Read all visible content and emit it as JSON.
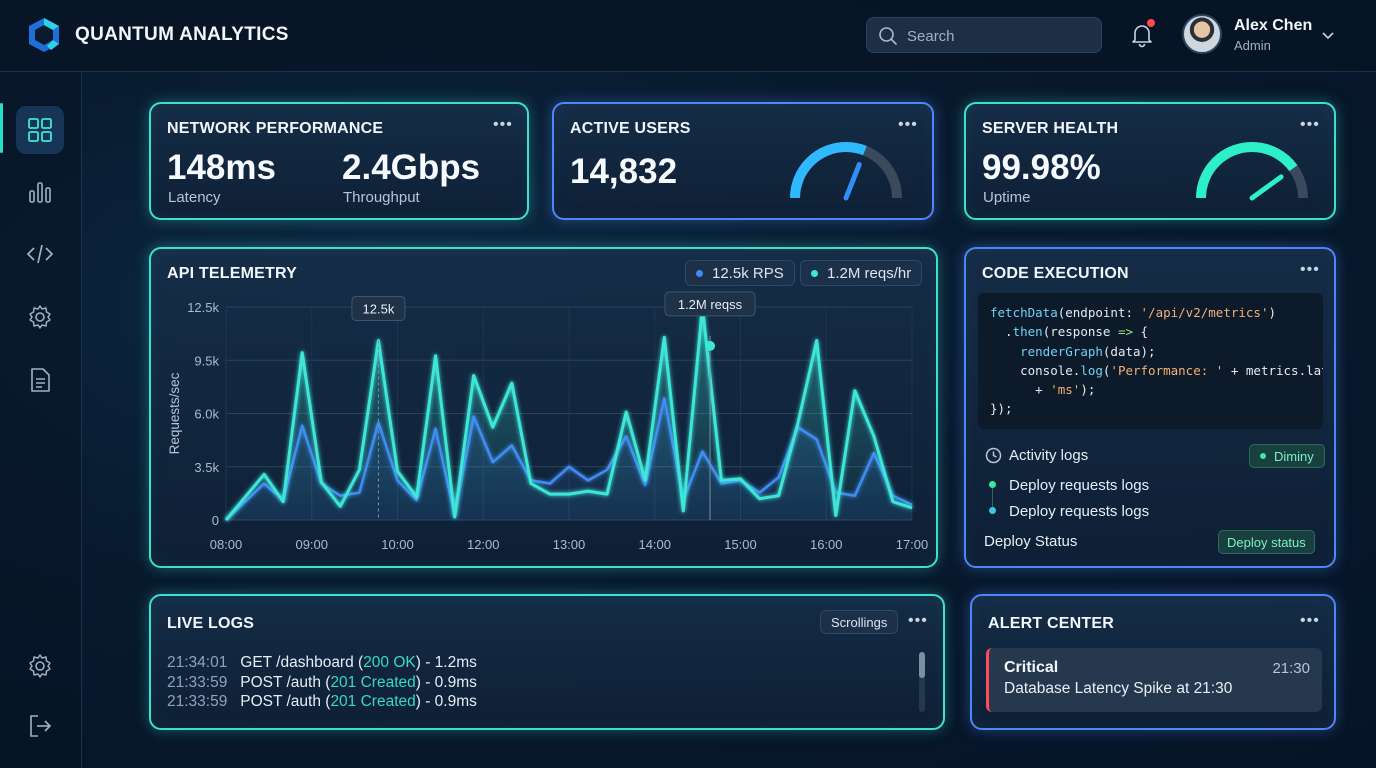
{
  "header": {
    "app_title": "QUANTUM ANALYTICS",
    "search_placeholder": "Search",
    "user_name": "Alex Chen",
    "user_role": "Admin"
  },
  "sidebar": {
    "items": [
      {
        "icon": "dashboard-icon",
        "active": true
      },
      {
        "icon": "bar-chart-icon",
        "active": false
      },
      {
        "icon": "code-icon",
        "active": false
      },
      {
        "icon": "settings-icon",
        "active": false
      },
      {
        "icon": "document-icon",
        "active": false
      }
    ],
    "bottom_items": [
      {
        "icon": "settings-icon"
      },
      {
        "icon": "logout-icon"
      }
    ]
  },
  "network": {
    "title": "NETWORK PERFORMANCE",
    "latency_value": "148ms",
    "latency_label": "Latency",
    "throughput_value": "2.4Gbps",
    "throughput_label": "Throughput"
  },
  "active_users": {
    "title": "ACTIVE USERS",
    "value": "14,832",
    "gauge_fraction": 0.62
  },
  "server_health": {
    "title": "SERVER HEALTH",
    "value": "99.98%",
    "label": "Uptime",
    "gauge_fraction": 0.8
  },
  "telemetry": {
    "title": "API TELEMETRY",
    "legend_rps": "12.5k RPS",
    "legend_reqs": "1.2M reqs/hr",
    "tooltip_peak": "12.5k",
    "tooltip_reqs": "1.2M reqss"
  },
  "chart_data": {
    "type": "line",
    "title": "API TELEMETRY",
    "ylabel": "Requests/sec",
    "xlabel": "",
    "ylim": [
      0,
      12500
    ],
    "y_ticks": [
      "0",
      "3.5k",
      "6.0k",
      "9.5k",
      "12.5k"
    ],
    "y_tick_values": [
      0,
      3500,
      7000,
      10500,
      14000
    ],
    "x_range": [
      8,
      17
    ],
    "x_ticks": [
      "08:00",
      "09:00",
      "10:00",
      "12:00",
      "13:00",
      "14:00",
      "15:00",
      "16:00",
      "17:00"
    ],
    "grid": true,
    "legend": "top-right",
    "series": [
      {
        "name": "12.5k RPS",
        "color": "#3ee6d6",
        "x": [
          8,
          8.5,
          8.75,
          9,
          9.25,
          9.5,
          9.75,
          10,
          10.25,
          10.5,
          10.75,
          11,
          11.25,
          11.5,
          11.75,
          12,
          12.25,
          12.5,
          12.75,
          13,
          13.25,
          13.5,
          13.75,
          14,
          14.25,
          14.5,
          14.75,
          15,
          15.25,
          15.5,
          15.75,
          16,
          16.25,
          16.5,
          16.75,
          17
        ],
        "y": [
          0,
          3000,
          1200,
          11000,
          2500,
          900,
          3300,
          11800,
          3200,
          1500,
          10800,
          200,
          9500,
          6100,
          9000,
          2400,
          1700,
          1700,
          1900,
          1700,
          7100,
          2600,
          12000,
          600,
          14000,
          2600,
          2700,
          1400,
          1600,
          6300,
          11800,
          300,
          8500,
          5500,
          1200,
          800
        ]
      },
      {
        "name": "1.2M reqs/hr",
        "color": "#3f8df2",
        "x": [
          8,
          8.5,
          8.75,
          9,
          9.25,
          9.5,
          9.75,
          10,
          10.25,
          10.5,
          10.75,
          11,
          11.25,
          11.5,
          11.75,
          12,
          12.25,
          12.5,
          12.75,
          13,
          13.25,
          13.5,
          13.75,
          14,
          14.25,
          14.5,
          14.75,
          15,
          15.25,
          15.5,
          15.75,
          16,
          16.25,
          16.5,
          16.75,
          17
        ],
        "y": [
          0,
          2400,
          1300,
          6200,
          2400,
          1600,
          1800,
          6400,
          2600,
          1300,
          6000,
          300,
          6800,
          3800,
          4900,
          2600,
          2400,
          3500,
          2600,
          3300,
          5500,
          2300,
          8000,
          1300,
          4500,
          2400,
          2600,
          1800,
          2800,
          6100,
          5300,
          1800,
          1600,
          4400,
          1600,
          1000
        ]
      }
    ]
  },
  "code_exec": {
    "title": "CODE EXECUTION",
    "activity_label": "Activity logs",
    "activity_badge": "Diminy",
    "log_items": [
      "Deploy requests logs",
      "Deploy requests logs"
    ],
    "deploy_label": "Deploy Status",
    "deploy_button": "Deploy status"
  },
  "live_logs": {
    "title": "LIVE LOGS",
    "scroll_button": "Scrollings",
    "entries": [
      {
        "time": "21:34:01",
        "method": "GET /dashboard (",
        "status": "200 OK",
        "rest": ") - 1.2ms"
      },
      {
        "time": "21:33:59",
        "method": "POST /auth (",
        "status": "201 Created",
        "rest": ") - 0.9ms"
      },
      {
        "time": "21:33:59",
        "method": "POST /auth (",
        "status": "201 Created",
        "rest": ") - 0.9ms"
      }
    ]
  },
  "alert_center": {
    "title": "ALERT CENTER",
    "alert_level": "Critical",
    "alert_time": "21:30",
    "alert_message": "Database Latency Spike at 21:30"
  }
}
